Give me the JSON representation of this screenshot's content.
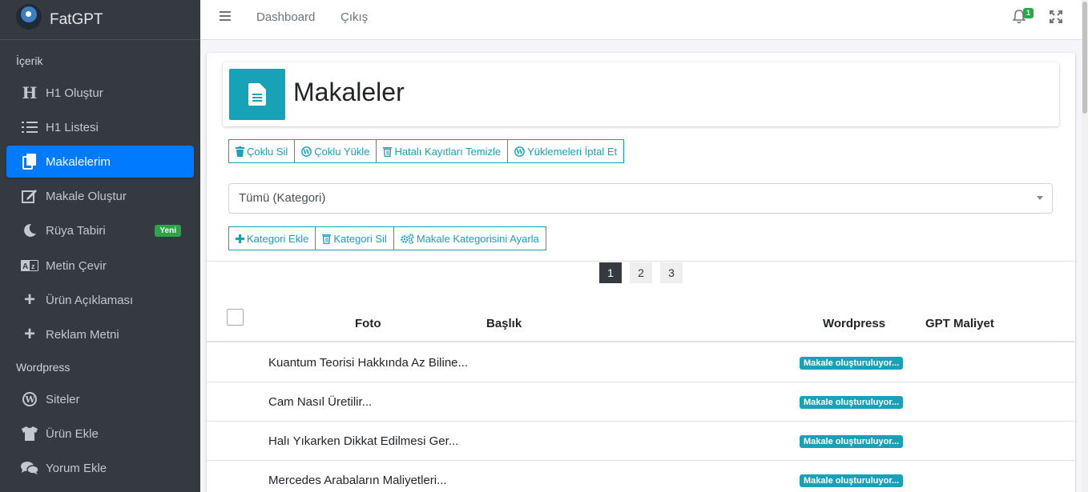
{
  "brand": {
    "name": "FatGPT"
  },
  "sidebar": {
    "sections": [
      {
        "header": "İçerik"
      },
      {
        "header": "Wordpress"
      }
    ],
    "items": [
      {
        "label": "H1 Oluştur",
        "icon": "heading-icon"
      },
      {
        "label": "H1 Listesi",
        "icon": "list-ol-icon"
      },
      {
        "label": "Makalelerim",
        "icon": "copy-icon",
        "active": true
      },
      {
        "label": "Makale Oluştur",
        "icon": "edit-icon"
      },
      {
        "label": "Rüya Tabiri",
        "icon": "moon-icon",
        "badge": "Yeni"
      },
      {
        "label": "Metin Çevir",
        "icon": "language-icon"
      },
      {
        "label": "Ürün Açıklaması",
        "icon": "plus-icon"
      },
      {
        "label": "Reklam Metni",
        "icon": "plus-icon"
      },
      {
        "label": "Siteler",
        "icon": "wordpress-icon"
      },
      {
        "label": "Ürün Ekle",
        "icon": "tshirt-icon"
      },
      {
        "label": "Yorum Ekle",
        "icon": "comments-icon"
      }
    ]
  },
  "topbar": {
    "links": [
      "Dashboard",
      "Çıkış"
    ],
    "notification_count": "1"
  },
  "page": {
    "title": "Makaleler"
  },
  "toolbar": {
    "buttons": [
      "Çoklu Sil",
      "Çoklu Yükle",
      "Hatalı Kayıtları Temizle",
      "Yüklemeleri İptal Et"
    ]
  },
  "filter": {
    "selected": "Tümü (Kategori)"
  },
  "category_toolbar": {
    "buttons": [
      "Kategori Ekle",
      "Kategori Sil",
      "Makale Kategorisini Ayarla"
    ]
  },
  "pagination": {
    "pages": [
      "1",
      "2",
      "3"
    ],
    "active": "1"
  },
  "table": {
    "columns": [
      "Foto",
      "Başlık",
      "Wordpress",
      "GPT Maliyet"
    ],
    "rows": [
      {
        "title": "Kuantum Teorisi Hakkında Az Biline...",
        "status": "Makale oluşturuluyor..."
      },
      {
        "title": "Cam Nasıl Üretilir...",
        "status": "Makale oluşturuluyor..."
      },
      {
        "title": "Halı Yıkarken Dikkat Edilmesi Ger...",
        "status": "Makale oluşturuluyor..."
      },
      {
        "title": "Mercedes Arabaların Maliyetleri...",
        "status": "Makale oluşturuluyor..."
      }
    ]
  },
  "colors": {
    "accent": "#17a2b8",
    "active_nav": "#007bff",
    "sidebar": "#343a40",
    "badge": "#28a745"
  }
}
